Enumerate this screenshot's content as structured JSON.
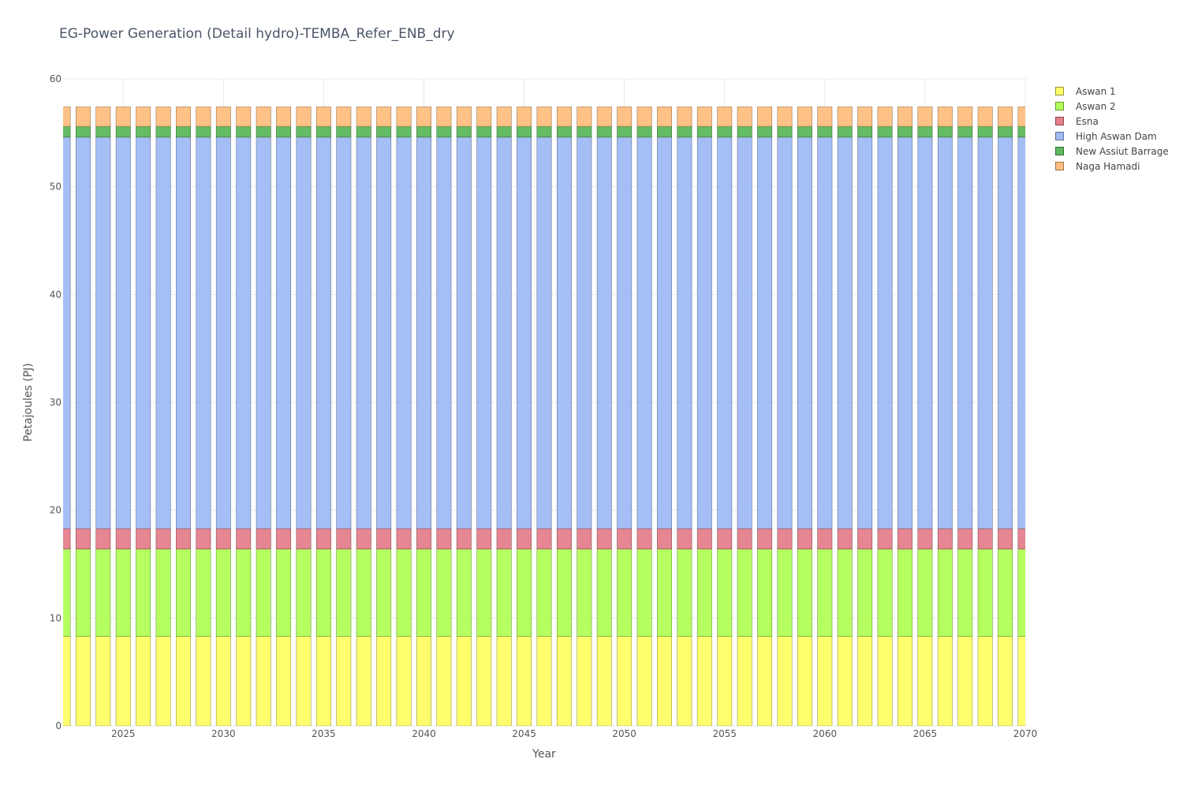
{
  "chart_data": {
    "type": "bar",
    "stacked": true,
    "title": "EG-Power Generation (Detail hydro)-TEMBA_Refer_ENB_dry",
    "xlabel": "Year",
    "ylabel": "Petajoules (PJ)",
    "xlim": [
      2022,
      2070
    ],
    "ylim": [
      0,
      60
    ],
    "xticks": [
      2025,
      2030,
      2035,
      2040,
      2045,
      2050,
      2055,
      2060,
      2065,
      2070
    ],
    "yticks": [
      0,
      10,
      20,
      30,
      40,
      50,
      60
    ],
    "grid": true,
    "legend_position": "top-right",
    "x": [
      2022,
      2023,
      2024,
      2025,
      2026,
      2027,
      2028,
      2029,
      2030,
      2031,
      2032,
      2033,
      2034,
      2035,
      2036,
      2037,
      2038,
      2039,
      2040,
      2041,
      2042,
      2043,
      2044,
      2045,
      2046,
      2047,
      2048,
      2049,
      2050,
      2051,
      2052,
      2053,
      2054,
      2055,
      2056,
      2057,
      2058,
      2059,
      2060,
      2061,
      2062,
      2063,
      2064,
      2065,
      2066,
      2067,
      2068,
      2069,
      2070
    ],
    "series": [
      {
        "name": "Aswan 1",
        "color": "#ffff66",
        "value": 8.3
      },
      {
        "name": "Aswan 2",
        "color": "#b2ff59",
        "value": 8.1
      },
      {
        "name": "Esna",
        "color": "#e57f8c",
        "value": 1.9
      },
      {
        "name": "High Aswan Dam",
        "color": "#a0bcf5",
        "value": 36.3
      },
      {
        "name": "New Assiut Barrage",
        "color": "#5cb85c",
        "value": 1.0
      },
      {
        "name": "Naga Hamadi",
        "color": "#ffbf80",
        "value": 1.8
      }
    ]
  }
}
